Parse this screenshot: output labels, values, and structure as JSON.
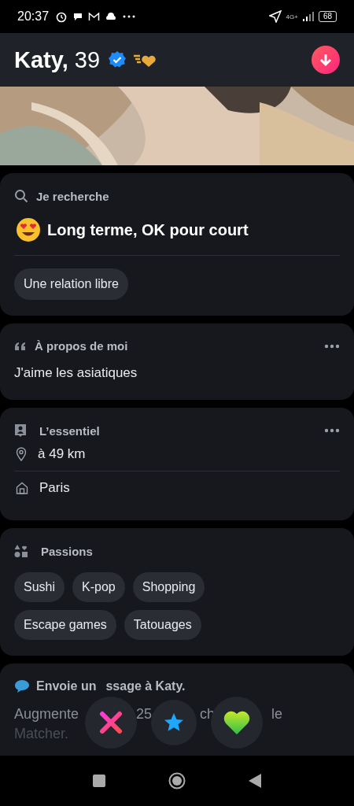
{
  "status_bar": {
    "time": "20:37",
    "network": "4G+",
    "battery": "68"
  },
  "profile": {
    "name": "Katy,",
    "age": "39",
    "verified": true
  },
  "looking_for": {
    "heading": "Je recherche",
    "goal": "Long terme, OK pour court",
    "tags": [
      "Une relation libre"
    ]
  },
  "about": {
    "heading": "À propos de moi",
    "text": "J'aime les asiatiques"
  },
  "essentials": {
    "heading": "L’essentiel",
    "items": [
      {
        "kind": "distance",
        "text": "à 49 km"
      },
      {
        "kind": "home",
        "text": "Paris"
      }
    ]
  },
  "passions": {
    "heading": "Passions",
    "tags": [
      "Sushi",
      "K-pop",
      "Shopping",
      "Escape games",
      "Tatouages"
    ]
  },
  "message": {
    "heading_parts": [
      "Envoie un",
      "ssage à Katy."
    ],
    "body_parts": [
      "Augmente",
      "25",
      "ch",
      "le"
    ],
    "body_last": "Matcher."
  },
  "actions": [
    {
      "kind": "nope"
    },
    {
      "kind": "super"
    },
    {
      "kind": "like"
    }
  ]
}
